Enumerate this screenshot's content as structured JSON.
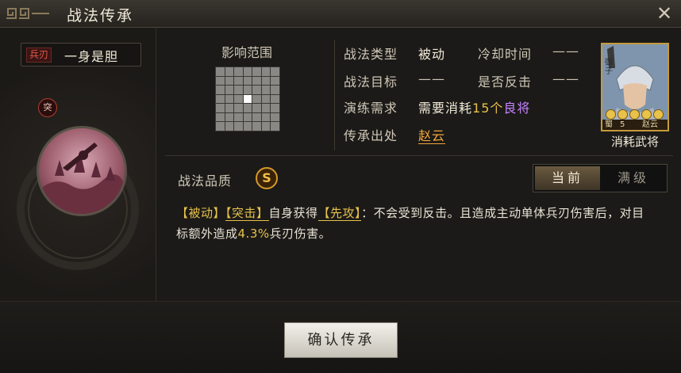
{
  "window": {
    "title": "战法传承"
  },
  "left": {
    "troop_tag": "兵刃",
    "skill_name": "一身是胆",
    "assault_badge": "突"
  },
  "range": {
    "title": "影响范围",
    "grid_size": 7,
    "highlighted_cell": [
      3,
      3
    ]
  },
  "info": {
    "type_label": "战法类型",
    "type_value": "被动",
    "cooldown_label": "冷却时间",
    "cooldown_value": "——",
    "target_label": "战法目标",
    "target_value": "——",
    "counter_label": "是否反击",
    "counter_value": "——",
    "req_label": "演练需求",
    "req_prefix": "需要消耗",
    "req_count": "15个",
    "req_item": "良将",
    "source_label": "传承出处",
    "source_value": "赵云"
  },
  "card": {
    "faction": "蜀",
    "cost": "5",
    "name": "赵云",
    "side_text": "御子",
    "stars": 5,
    "caption": "消耗武将"
  },
  "quality": {
    "label": "战法品质",
    "grade": "S"
  },
  "toggle": {
    "current": "当前",
    "max": "满级"
  },
  "description": {
    "tag1": "【被动】",
    "tag2": "【突击】",
    "text1": "自身获得",
    "tag3": "【先攻】",
    "text2": "：不会受到反击。且造成主动单体兵刃伤害后，对目标额外造成",
    "pct": "4.3%",
    "text3": "兵刃伤害。"
  },
  "footer": {
    "confirm": "确认传承"
  },
  "colors": {
    "gold": "#e7c14a",
    "purple": "#c583ff",
    "orange": "#f1a53a",
    "red": "#e05a4a"
  }
}
